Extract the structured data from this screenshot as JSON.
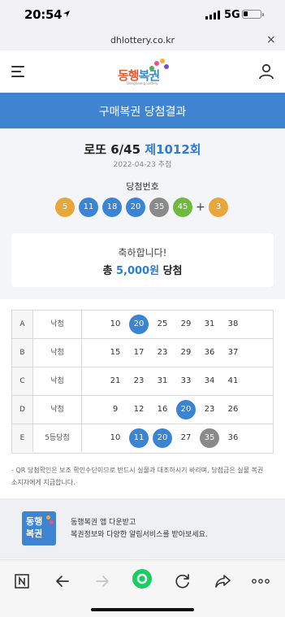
{
  "status_bar": {
    "time": "20:54",
    "network": "5G"
  },
  "browser": {
    "url": "dhlottery.co.kr",
    "close_glyph": "×"
  },
  "site": {
    "logo_text_1": "동행",
    "logo_text_2": "복권",
    "logo_sub": "Donghaeng Lottery"
  },
  "banner": {
    "title": "구매복권 당첨결과"
  },
  "draw": {
    "game": "로또 6/45",
    "round": "제1012회",
    "date": "2022-04-23 추첨",
    "label": "당첨번호",
    "numbers": [
      "5",
      "11",
      "18",
      "20",
      "35",
      "45"
    ],
    "plus": "+",
    "bonus": "3"
  },
  "result": {
    "congrats": "축하합니다!",
    "total_prefix": "총",
    "amount": "5,000원",
    "total_suffix": "당첨"
  },
  "tickets": [
    {
      "letter": "A",
      "result": "낙첨",
      "numbers": [
        "10",
        "20",
        "25",
        "29",
        "31",
        "38"
      ]
    },
    {
      "letter": "B",
      "result": "낙첨",
      "numbers": [
        "15",
        "17",
        "23",
        "29",
        "36",
        "37"
      ]
    },
    {
      "letter": "C",
      "result": "낙첨",
      "numbers": [
        "21",
        "23",
        "31",
        "33",
        "34",
        "41"
      ]
    },
    {
      "letter": "D",
      "result": "낙첨",
      "numbers": [
        "9",
        "12",
        "16",
        "20",
        "23",
        "26"
      ]
    },
    {
      "letter": "E",
      "result": "5등당첨",
      "numbers": [
        "10",
        "11",
        "20",
        "27",
        "35",
        "36"
      ]
    }
  ],
  "notice": {
    "line1": "- QR 당첨확인은 보조 확인수단이므로 반드시 실물과 대조하시기 바라며, 당첨금은 실물 복권",
    "line2": "소지자에게 지급합니다."
  },
  "app_banner": {
    "icon_line1": "동행",
    "icon_line2": "복권",
    "line1": "동행복권 앱 다운받고",
    "line2": "복권정보와 다양한 알림서비스를 받아보세요."
  },
  "colors": {
    "accent": "#3e84d0",
    "ball_yellow": "#e7a73a",
    "ball_blue": "#3b83d3",
    "ball_gray": "#8a8a8a",
    "ball_green": "#6dba3c"
  }
}
